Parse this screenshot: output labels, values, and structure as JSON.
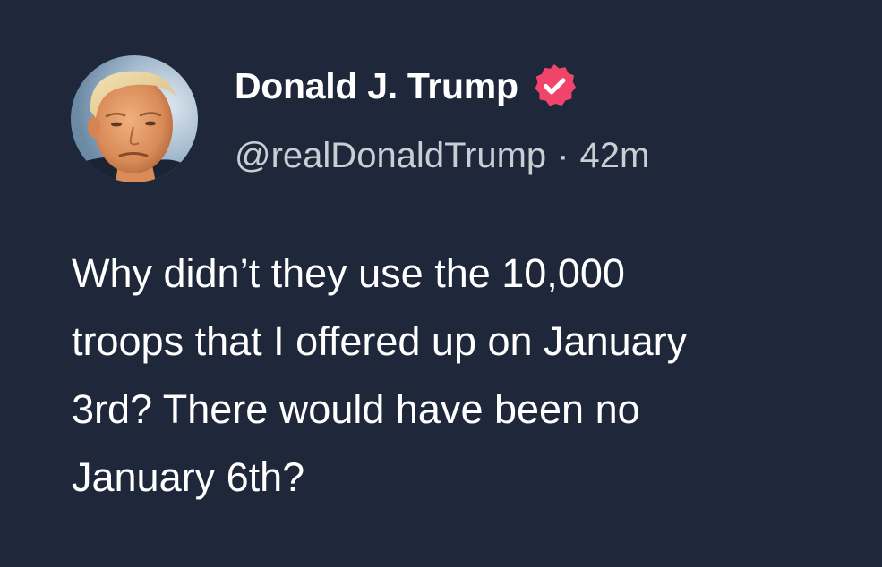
{
  "post": {
    "author": {
      "display_name": "Donald J. Trump",
      "handle": "@realDonaldTrump",
      "verified_icon": "verified-badge-icon",
      "verified_color": "#f0446b"
    },
    "separator": "·",
    "timestamp": "42m",
    "text": "Why didn’t they use the 10,000\ntroops that I offered up on January\n3rd? There would have been no\nJanuary 6th?"
  },
  "colors": {
    "background": "#1f283a",
    "text_primary": "#ffffff",
    "text_secondary": "#c9cdd4"
  }
}
